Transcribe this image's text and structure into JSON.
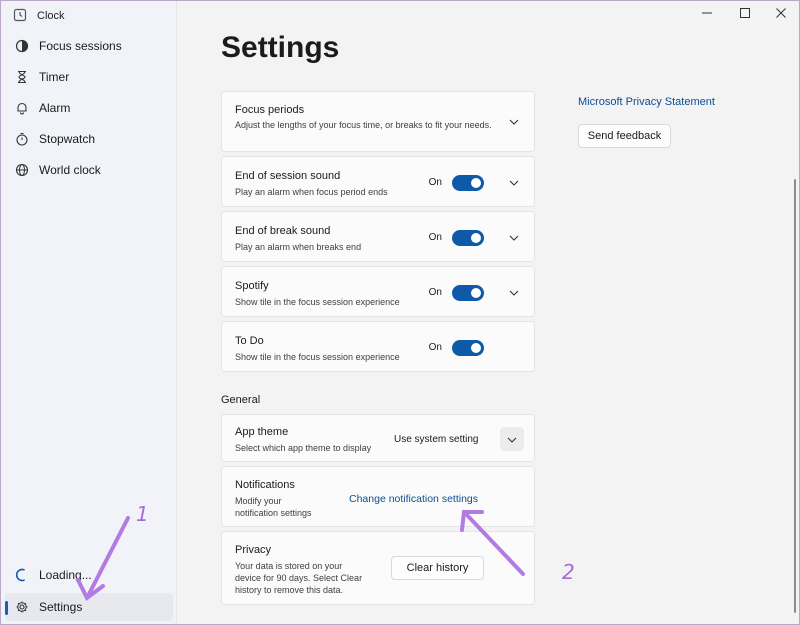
{
  "app": {
    "title": "Clock"
  },
  "sidebar": {
    "items": [
      {
        "label": "Focus sessions",
        "icon": "focus-icon"
      },
      {
        "label": "Timer",
        "icon": "hourglass-icon"
      },
      {
        "label": "Alarm",
        "icon": "bell-icon"
      },
      {
        "label": "Stopwatch",
        "icon": "stopwatch-icon"
      },
      {
        "label": "World clock",
        "icon": "globe-icon"
      }
    ],
    "loading_label": "Loading...",
    "settings_label": "Settings"
  },
  "page": {
    "title": "Settings"
  },
  "focus": {
    "periods": {
      "title": "Focus periods",
      "desc": "Adjust the lengths of your focus time, or breaks to fit your needs."
    },
    "end_session": {
      "title": "End of session sound",
      "desc": "Play an alarm when focus period ends",
      "state": "On"
    },
    "end_break": {
      "title": "End of break sound",
      "desc": "Play an alarm when breaks end",
      "state": "On"
    },
    "spotify": {
      "title": "Spotify",
      "desc": "Show tile in the focus session experience",
      "state": "On"
    },
    "todo": {
      "title": "To Do",
      "desc": "Show tile in the focus session experience",
      "state": "On"
    }
  },
  "general": {
    "label": "General",
    "theme": {
      "title": "App theme",
      "desc": "Select which app theme to display",
      "value": "Use system setting"
    },
    "notifications": {
      "title": "Notifications",
      "desc_line1": "Modify your",
      "desc_line2": "notification settings",
      "link": "Change notification settings"
    },
    "privacy": {
      "title": "Privacy",
      "desc_line1": "Your data is stored on your",
      "desc_line2": "device for 90 days. Select Clear",
      "desc_line3": "history to remove this data.",
      "button": "Clear history"
    }
  },
  "right": {
    "privacy_link": "Microsoft Privacy Statement",
    "feedback_button": "Send feedback"
  },
  "annotations": {
    "one": "1",
    "two": "2"
  },
  "colors": {
    "accent": "#0f5aa8",
    "annotation": "#a86bdc",
    "link": "#0e4d92"
  }
}
